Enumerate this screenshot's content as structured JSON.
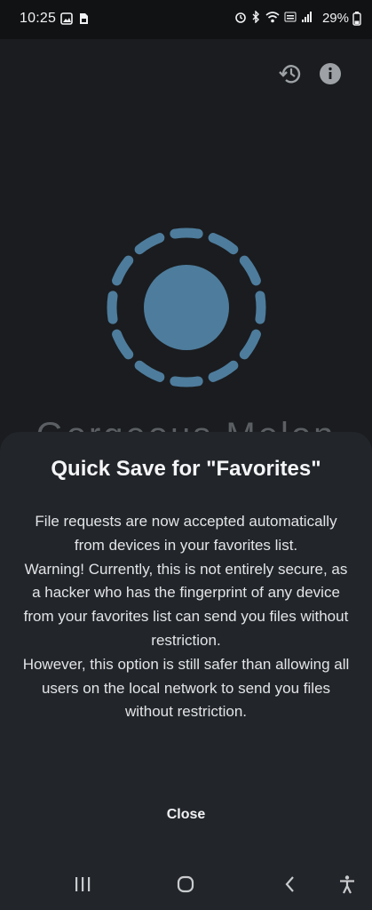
{
  "status_bar": {
    "time": "10:25",
    "battery": "29%",
    "left_icons": [
      "gallery-icon",
      "sim-card-icon"
    ],
    "right_icons": [
      "alarm-icon",
      "bluetooth-icon",
      "wifi-icon",
      "volte-icon",
      "signal-icon",
      "battery-icon"
    ]
  },
  "top_bar": {
    "icons": [
      "history-icon",
      "info-icon"
    ]
  },
  "background": {
    "device_name": "Gorgeous Melon",
    "logo_color": "#4e7c9c"
  },
  "sheet": {
    "title": "Quick Save for \"Favorites\"",
    "paragraphs": [
      "File requests are now accepted automatically from devices in your favorites list.",
      "Warning! Currently, this is not entirely secure, as a hacker who has the fingerprint of any device from your favorites list can send you files without restriction.",
      "However, this option is still safer than allowing all users on the local network to send you files without restriction."
    ],
    "close_label": "Close"
  },
  "nav_bar": {
    "icons": [
      "recent-apps-icon",
      "home-icon",
      "back-icon",
      "accessibility-icon"
    ]
  }
}
